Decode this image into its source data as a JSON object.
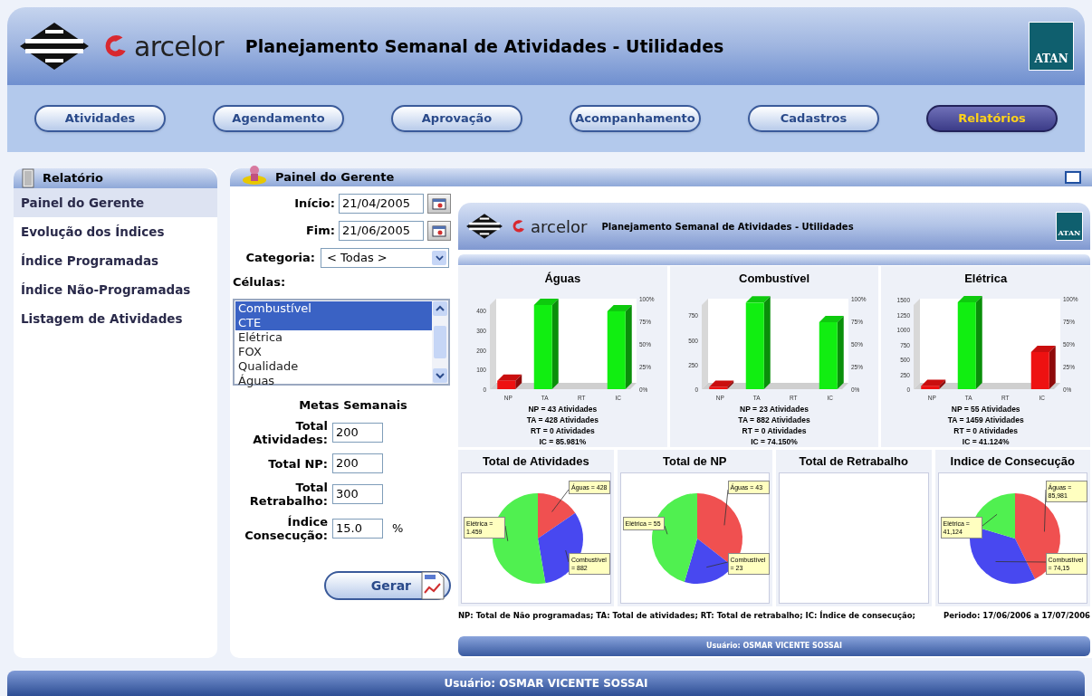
{
  "header": {
    "brand": "arcelor",
    "title": "Planejamento Semanal de Atividades - Utilidades",
    "logo_text": "ATAN"
  },
  "nav": [
    {
      "label": "Atividades",
      "selected": false
    },
    {
      "label": "Agendamento",
      "selected": false
    },
    {
      "label": "Aprovação",
      "selected": false
    },
    {
      "label": "Acompanhamento",
      "selected": false
    },
    {
      "label": "Cadastros",
      "selected": false
    },
    {
      "label": "Relatórios",
      "selected": true
    }
  ],
  "sidebar": {
    "title": "Relatório",
    "items": [
      {
        "label": "Painel do Gerente",
        "selected": true
      },
      {
        "label": "Evolução dos Índices",
        "selected": false
      },
      {
        "label": "Índice Programadas",
        "selected": false
      },
      {
        "label": "Índice Não-Programadas",
        "selected": false
      },
      {
        "label": "Listagem de Atividades",
        "selected": false
      }
    ]
  },
  "panel": {
    "title": "Painel do Gerente",
    "form": {
      "dates": [
        {
          "label": "Início:",
          "value": "21/04/2005"
        },
        {
          "label": "Fim:",
          "value": "21/06/2005"
        }
      ],
      "categoria": {
        "label": "Categoria:",
        "value": "< Todas >"
      },
      "celulas": {
        "label": "Células:",
        "options": [
          {
            "label": "Combustível",
            "selected": true
          },
          {
            "label": "CTE",
            "selected": true
          },
          {
            "label": "Elétrica",
            "selected": false
          },
          {
            "label": "FOX",
            "selected": false
          },
          {
            "label": "Qualidade",
            "selected": false
          },
          {
            "label": "Águas",
            "selected": false
          }
        ]
      },
      "metas_title": "Metas Semanais",
      "metas": [
        {
          "label": "Total Atividades:",
          "value": "200"
        },
        {
          "label": "Total NP:",
          "value": "200"
        },
        {
          "label": "Total Retrabalho:",
          "value": "300"
        },
        {
          "label": "Índice Consecução:",
          "value": "15.0",
          "unit": "%"
        }
      ],
      "button": "Gerar"
    },
    "report": {
      "brand": "arcelor",
      "title": "Planejamento Semanal de Atividades - Utilidades",
      "logo_text": "ATAN",
      "bar_charts": [
        {
          "chart_data": {
            "type": "bar",
            "title": "Águas",
            "categories": [
              "NP",
              "TA",
              "RT",
              "IC"
            ],
            "ylim": [
              0,
              460
            ],
            "yticks": [
              0,
              100,
              200,
              300,
              400
            ],
            "y2lim": [
              0,
              100
            ],
            "y2ticks": [
              {
                "value": 0,
                "label": "0%"
              },
              {
                "value": 25,
                "label": "25%"
              },
              {
                "value": 50,
                "label": "50%"
              },
              {
                "value": 75,
                "label": "75%"
              },
              {
                "value": 100,
                "label": "100%"
              }
            ],
            "series": [
              {
                "color": "#ee1111",
                "values": [
                  43,
                  null,
                  null,
                  null
                ]
              },
              {
                "color": "#11ee11",
                "values": [
                  null,
                  428,
                  0,
                  null
                ]
              },
              {
                "color": "#11ee11",
                "axis": "y2",
                "values": [
                  null,
                  null,
                  null,
                  86
                ]
              }
            ]
          },
          "summary": [
            "NP = 43 Atividades",
            "TA = 428 Atividades",
            "RT = 0 Atividades",
            "IC = 85.981%"
          ]
        },
        {
          "chart_data": {
            "type": "bar",
            "title": "Combustível",
            "categories": [
              "NP",
              "TA",
              "RT",
              "IC"
            ],
            "ylim": [
              0,
              920
            ],
            "yticks": [
              0,
              250,
              500,
              750
            ],
            "y2lim": [
              0,
              100
            ],
            "y2ticks": [
              {
                "value": 0,
                "label": "0%"
              },
              {
                "value": 25,
                "label": "25%"
              },
              {
                "value": 50,
                "label": "50%"
              },
              {
                "value": 75,
                "label": "75%"
              },
              {
                "value": 100,
                "label": "100%"
              }
            ],
            "series": [
              {
                "color": "#ee1111",
                "values": [
                  23,
                  null,
                  null,
                  null
                ]
              },
              {
                "color": "#11ee11",
                "values": [
                  null,
                  880,
                  0,
                  null
                ]
              },
              {
                "color": "#11ee11",
                "axis": "y2",
                "values": [
                  null,
                  null,
                  null,
                  74
                ]
              }
            ]
          },
          "summary": [
            "NP = 23 Atividades",
            "TA = 882 Atividades",
            "RT = 0 Atividades",
            "IC = 74.150%"
          ]
        },
        {
          "chart_data": {
            "type": "bar",
            "title": "Elétrica",
            "categories": [
              "NP",
              "TA",
              "RT",
              "IC"
            ],
            "ylim": [
              0,
              1520
            ],
            "yticks": [
              0,
              250,
              500,
              750,
              1000,
              1250,
              1500
            ],
            "y2lim": [
              0,
              100
            ],
            "y2ticks": [
              {
                "value": 0,
                "label": "0%"
              },
              {
                "value": 25,
                "label": "25%"
              },
              {
                "value": 50,
                "label": "50%"
              },
              {
                "value": 75,
                "label": "75%"
              },
              {
                "value": 100,
                "label": "100%"
              }
            ],
            "series": [
              {
                "color": "#ee1111",
                "values": [
                  55,
                  null,
                  null,
                  null
                ]
              },
              {
                "color": "#11ee11",
                "values": [
                  null,
                  1460,
                  0,
                  null
                ]
              },
              {
                "color": "#ee1111",
                "axis": "y2",
                "values": [
                  null,
                  null,
                  null,
                  41
                ]
              }
            ]
          },
          "summary": [
            "NP = 55 Atividades",
            "TA = 1459 Atividades",
            "RT = 0 Atividades",
            "IC = 41.124%"
          ]
        }
      ],
      "pies": [
        {
          "title": "Total de Atividades",
          "chart_data": {
            "type": "pie",
            "series": [
              {
                "values": [
                  15.46,
                  31.85,
                  52.69
                ]
              }
            ],
            "colors": [
              "#f05050",
              "#4848f0",
              "#50f050"
            ],
            "annotations": [
              "Águas = 428",
              "Combustível = 882",
              "Elétrica = 1.459"
            ]
          }
        },
        {
          "title": "Total de NP",
          "chart_data": {
            "type": "pie",
            "series": [
              {
                "values": [
                  35.54,
                  19.01,
                  45.45
                ]
              }
            ],
            "colors": [
              "#f05050",
              "#4848f0",
              "#50f050"
            ],
            "annotations": [
              "Águas = 43",
              "Combustível = 23",
              "Elétrica = 55"
            ]
          }
        },
        {
          "title": "Total de Retrabalho"
        },
        {
          "title": "Indice de Consecução",
          "chart_data": {
            "type": "pie",
            "series": [
              {
                "values": [
                  42.72,
                  36.84,
                  20.44
                ]
              }
            ],
            "colors": [
              "#f05050",
              "#4848f0",
              "#50f050"
            ],
            "annotations": [
              "Águas = 85,981",
              "Combustível = 74,15",
              "Elétrica = 41,124"
            ]
          }
        }
      ],
      "legend": "NP: Total de Não programadas; TA: Total de atividades; RT: Total de retrabalho; IC: Índice de consecução;",
      "period": "Periodo: 17/06/2006 a 17/07/2006",
      "user": "Usuário: OSMAR VICENTE SOSSAI"
    }
  },
  "footer": {
    "user": "Usuário: OSMAR VICENTE SOSSAI"
  }
}
